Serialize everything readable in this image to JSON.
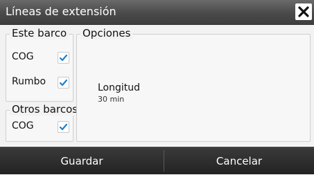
{
  "dialog": {
    "title": "Líneas de extensión",
    "close_icon": "close-icon"
  },
  "own_vessel": {
    "legend": "Este barco",
    "items": [
      {
        "label": "COG",
        "checked": true
      },
      {
        "label": "Rumbo",
        "checked": true
      }
    ]
  },
  "other_vessels": {
    "legend": "Otros barcos",
    "items": [
      {
        "label": "COG",
        "checked": true
      }
    ]
  },
  "options": {
    "legend": "Opciones",
    "length_label": "Longitud",
    "length_value": "30 min"
  },
  "footer": {
    "save_label": "Guardar",
    "cancel_label": "Cancelar"
  },
  "colors": {
    "accent": "#1f7fc9",
    "titlebar": "#4a4a4a",
    "footer": "#2b2b2b"
  }
}
